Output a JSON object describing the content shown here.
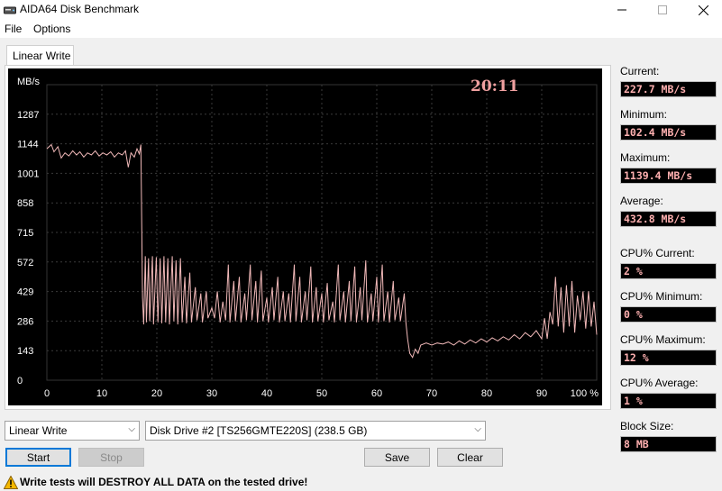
{
  "window": {
    "title": "AIDA64 Disk Benchmark"
  },
  "menu": {
    "file": "File",
    "options": "Options"
  },
  "tab": {
    "label": "Linear Write"
  },
  "chart_data": {
    "type": "line",
    "time_label": "20:11",
    "ylabel": "MB/s",
    "y_ticks": [
      "1287",
      "1144",
      "1001",
      "858",
      "715",
      "572",
      "429",
      "286",
      "143",
      "0"
    ],
    "x_ticks": [
      "0",
      "10",
      "20",
      "30",
      "40",
      "50",
      "60",
      "70",
      "80",
      "90",
      "100 %"
    ],
    "ylim": [
      0,
      1430
    ],
    "xlim": [
      0,
      100
    ],
    "line_color": "#f0b8b8",
    "series": [
      {
        "values": [
          [
            0,
            1120
          ],
          [
            0.8,
            1140
          ],
          [
            1.3,
            1105
          ],
          [
            2,
            1130
          ],
          [
            2.6,
            1075
          ],
          [
            3.3,
            1100
          ],
          [
            4,
            1085
          ],
          [
            4.7,
            1110
          ],
          [
            5.4,
            1090
          ],
          [
            6,
            1105
          ],
          [
            6.7,
            1080
          ],
          [
            7.4,
            1100
          ],
          [
            8.1,
            1090
          ],
          [
            8.8,
            1110
          ],
          [
            9.5,
            1085
          ],
          [
            10.2,
            1100
          ],
          [
            10.9,
            1090
          ],
          [
            11.6,
            1105
          ],
          [
            12.3,
            1080
          ],
          [
            13,
            1100
          ],
          [
            13.7,
            1090
          ],
          [
            14.3,
            1110
          ],
          [
            14.8,
            1030
          ],
          [
            15.3,
            1100
          ],
          [
            15.9,
            1080
          ],
          [
            16.4,
            1120
          ],
          [
            16.8,
            1095
          ],
          [
            17.1,
            1140
          ],
          [
            17.4,
            400
          ],
          [
            17.6,
            270
          ],
          [
            17.9,
            600
          ],
          [
            18.1,
            280
          ],
          [
            18.5,
            590
          ],
          [
            18.7,
            285
          ],
          [
            19.2,
            600
          ],
          [
            19.4,
            270
          ],
          [
            19.9,
            595
          ],
          [
            20.2,
            280
          ],
          [
            20.6,
            590
          ],
          [
            20.9,
            275
          ],
          [
            21.3,
            600
          ],
          [
            21.6,
            280
          ],
          [
            22,
            590
          ],
          [
            22.3,
            270
          ],
          [
            22.8,
            600
          ],
          [
            23.1,
            285
          ],
          [
            23.5,
            580
          ],
          [
            23.8,
            270
          ],
          [
            24.3,
            590
          ],
          [
            24.6,
            280
          ],
          [
            25.1,
            500
          ],
          [
            25.4,
            275
          ],
          [
            26,
            520
          ],
          [
            26.3,
            280
          ],
          [
            27,
            450
          ],
          [
            27.3,
            290
          ],
          [
            28,
            420
          ],
          [
            28.3,
            280
          ],
          [
            29,
            430
          ],
          [
            29.3,
            300
          ],
          [
            30,
            350
          ],
          [
            30.5,
            300
          ],
          [
            31,
            430
          ],
          [
            31.5,
            280
          ],
          [
            32,
            380
          ],
          [
            32.5,
            290
          ],
          [
            33,
            560
          ],
          [
            33.3,
            280
          ],
          [
            34,
            480
          ],
          [
            34.3,
            285
          ],
          [
            35,
            500
          ],
          [
            35.3,
            280
          ],
          [
            36,
            420
          ],
          [
            36.3,
            290
          ],
          [
            37,
            560
          ],
          [
            37.3,
            290
          ],
          [
            38,
            480
          ],
          [
            38.3,
            280
          ],
          [
            39,
            530
          ],
          [
            39.3,
            285
          ],
          [
            40,
            400
          ],
          [
            40.3,
            280
          ],
          [
            41,
            450
          ],
          [
            41.3,
            290
          ],
          [
            42,
            500
          ],
          [
            42.3,
            280
          ],
          [
            43,
            430
          ],
          [
            43.3,
            285
          ],
          [
            44,
            420
          ],
          [
            44.3,
            280
          ],
          [
            45,
            560
          ],
          [
            45.3,
            285
          ],
          [
            46,
            500
          ],
          [
            46.3,
            280
          ],
          [
            47,
            430
          ],
          [
            47.3,
            290
          ],
          [
            48,
            550
          ],
          [
            48.3,
            280
          ],
          [
            49,
            450
          ],
          [
            49.3,
            285
          ],
          [
            50,
            420
          ],
          [
            50.3,
            280
          ],
          [
            51,
            470
          ],
          [
            51.3,
            290
          ],
          [
            52,
            380
          ],
          [
            52.3,
            280
          ],
          [
            53,
            560
          ],
          [
            53.3,
            290
          ],
          [
            54,
            430
          ],
          [
            54.3,
            280
          ],
          [
            55,
            480
          ],
          [
            55.3,
            285
          ],
          [
            56,
            550
          ],
          [
            56.3,
            280
          ],
          [
            57,
            450
          ],
          [
            57.3,
            290
          ],
          [
            58,
            580
          ],
          [
            58.3,
            280
          ],
          [
            59,
            420
          ],
          [
            59.3,
            285
          ],
          [
            60,
            500
          ],
          [
            60.3,
            280
          ],
          [
            61,
            560
          ],
          [
            61.3,
            285
          ],
          [
            62,
            430
          ],
          [
            62.3,
            280
          ],
          [
            63,
            480
          ],
          [
            63.3,
            290
          ],
          [
            64,
            400
          ],
          [
            64.3,
            285
          ],
          [
            65,
            420
          ],
          [
            65.3,
            280
          ],
          [
            65.6,
            200
          ],
          [
            66,
            130
          ],
          [
            66.5,
            110
          ],
          [
            67,
            150
          ],
          [
            67.5,
            130
          ],
          [
            68,
            170
          ],
          [
            69,
            180
          ],
          [
            70,
            170
          ],
          [
            71,
            180
          ],
          [
            72,
            175
          ],
          [
            73,
            185
          ],
          [
            74,
            170
          ],
          [
            75,
            190
          ],
          [
            76,
            175
          ],
          [
            77,
            195
          ],
          [
            78,
            180
          ],
          [
            79,
            200
          ],
          [
            80,
            185
          ],
          [
            81,
            205
          ],
          [
            82,
            190
          ],
          [
            83,
            210
          ],
          [
            84,
            195
          ],
          [
            85,
            220
          ],
          [
            86,
            200
          ],
          [
            87,
            230
          ],
          [
            88,
            210
          ],
          [
            89,
            240
          ],
          [
            90,
            200
          ],
          [
            90.5,
            300
          ],
          [
            91,
            200
          ],
          [
            91.5,
            330
          ],
          [
            92,
            270
          ],
          [
            92.5,
            500
          ],
          [
            93,
            260
          ],
          [
            93.5,
            450
          ],
          [
            94,
            230
          ],
          [
            94.5,
            460
          ],
          [
            95,
            260
          ],
          [
            95.5,
            480
          ],
          [
            96,
            230
          ],
          [
            96.5,
            410
          ],
          [
            97,
            290
          ],
          [
            97.5,
            430
          ],
          [
            98,
            250
          ],
          [
            98.5,
            430
          ],
          [
            99,
            260
          ],
          [
            99.5,
            380
          ],
          [
            100,
            220
          ]
        ]
      }
    ]
  },
  "sidebar": {
    "current_label": "Current:",
    "current_value": "227.7 MB/s",
    "minimum_label": "Minimum:",
    "minimum_value": "102.4 MB/s",
    "maximum_label": "Maximum:",
    "maximum_value": "1139.4 MB/s",
    "average_label": "Average:",
    "average_value": "432.8 MB/s",
    "cpu_current_label": "CPU% Current:",
    "cpu_current_value": "2 %",
    "cpu_minimum_label": "CPU% Minimum:",
    "cpu_minimum_value": "0 %",
    "cpu_maximum_label": "CPU% Maximum:",
    "cpu_maximum_value": "12 %",
    "cpu_average_label": "CPU% Average:",
    "cpu_average_value": "1 %",
    "block_size_label": "Block Size:",
    "block_size_value": "8 MB"
  },
  "controls": {
    "test_select": "Linear Write",
    "drive_select": "Disk Drive #2  [TS256GMTE220S]  (238.5 GB)",
    "start": "Start",
    "stop": "Stop",
    "save": "Save",
    "clear": "Clear"
  },
  "warning": {
    "text": "Write tests will DESTROY ALL DATA on the tested drive!"
  },
  "icons": {
    "app": "disk-drive-icon",
    "warning": "warning-icon",
    "dropdown": "chevron-down-icon"
  }
}
